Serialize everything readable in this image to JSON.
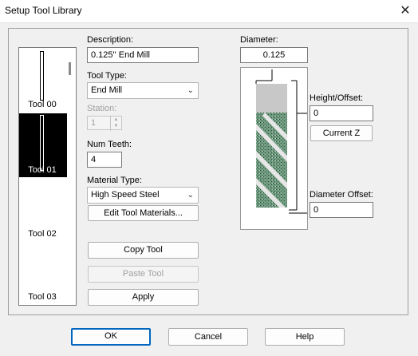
{
  "window": {
    "title": "Setup Tool Library",
    "close_glyph": "✕"
  },
  "tools": [
    {
      "label": "Tool 00",
      "selected": false
    },
    {
      "label": "Tool 01",
      "selected": true
    },
    {
      "label": "Tool 02",
      "selected": false
    },
    {
      "label": "Tool 03",
      "selected": false
    }
  ],
  "form": {
    "description_label": "Description:",
    "description_value": "0.125'' End Mill",
    "tool_type_label": "Tool Type:",
    "tool_type_value": "End Mill",
    "station_label": "Station:",
    "station_value": "1",
    "num_teeth_label": "Num Teeth:",
    "num_teeth_value": "4",
    "material_type_label": "Material Type:",
    "material_type_value": "High Speed Steel",
    "edit_materials_button": "Edit Tool Materials...",
    "copy_tool_button": "Copy Tool",
    "paste_tool_button": "Paste Tool",
    "apply_button": "Apply"
  },
  "geometry": {
    "diameter_label": "Diameter:",
    "diameter_value": "0.125",
    "height_offset_label": "Height/Offset:",
    "height_offset_value": "0",
    "current_z_button": "Current Z",
    "diameter_offset_label": "Diameter Offset:",
    "diameter_offset_value": "0"
  },
  "footer": {
    "ok": "OK",
    "cancel": "Cancel",
    "help": "Help"
  },
  "colors": {
    "accent": "#0067c0",
    "selection": "#000000",
    "shank": "#c8c8c8",
    "flute": "#5f8a72"
  }
}
